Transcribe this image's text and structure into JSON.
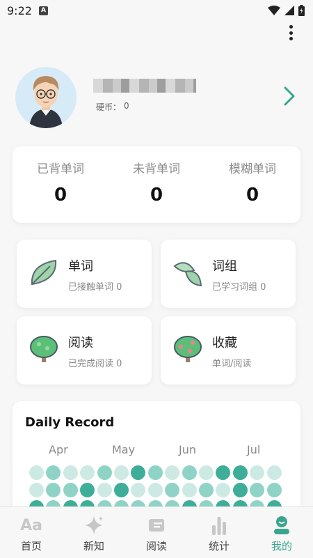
{
  "status_bar": {
    "time": "9:22",
    "notif_letter": "A"
  },
  "profile": {
    "coins_label": "硬币：",
    "coins_value": "0"
  },
  "stats": [
    {
      "label": "已背单词",
      "value": "0"
    },
    {
      "label": "未背单词",
      "value": "0"
    },
    {
      "label": "模糊单词",
      "value": "0"
    }
  ],
  "tiles": {
    "words": {
      "title": "单词",
      "subtitle": "已接触单词 0"
    },
    "phrases": {
      "title": "词组",
      "subtitle": "已学习词组 0"
    },
    "reading": {
      "title": "阅读",
      "subtitle": "已完成阅读 0"
    },
    "favorites": {
      "title": "收藏",
      "subtitle": "单词/阅读"
    }
  },
  "daily_record": {
    "title": "Daily Record",
    "months": [
      "Apr",
      "May",
      "Jun",
      "Jul"
    ],
    "colors": {
      "light": "#cde9e4",
      "mid": "#8fd3c6",
      "dark": "#3fae98"
    },
    "rows": [
      [
        "light",
        "mid",
        "light",
        "light",
        "mid",
        "light",
        "dark",
        "mid",
        "light",
        "mid",
        "light",
        "dark",
        "dark",
        "light",
        "light"
      ],
      [
        "light",
        "mid",
        "mid",
        "dark",
        "light",
        "dark",
        "light",
        "light",
        "mid",
        "light",
        "mid",
        "light",
        "dark",
        "mid",
        "mid"
      ],
      [
        "dark",
        "mid",
        "dark",
        "dark",
        "mid",
        "mid",
        "mid",
        "mid",
        "mid",
        "dark",
        "mid",
        "dark",
        "dark",
        "mid",
        "dark"
      ]
    ]
  },
  "nav": [
    {
      "label": "首页",
      "icon": "aa-icon"
    },
    {
      "label": "新知",
      "icon": "sparkle-icon"
    },
    {
      "label": "阅读",
      "icon": "ticket-icon"
    },
    {
      "label": "统计",
      "icon": "bar-chart-icon"
    },
    {
      "label": "我的",
      "icon": "person-icon",
      "active": true
    }
  ],
  "accent_color": "#3aa58e"
}
